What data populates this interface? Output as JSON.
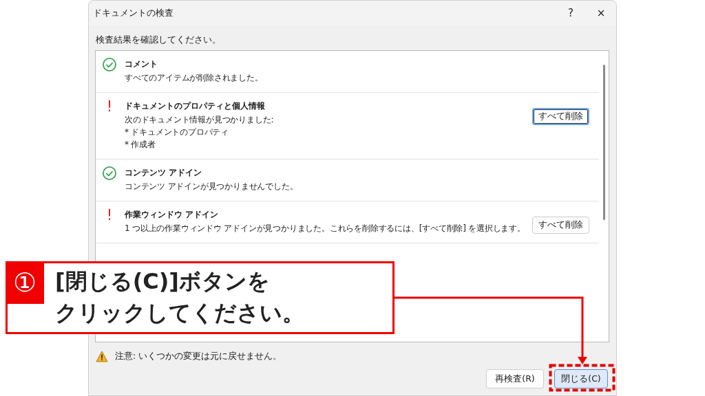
{
  "window": {
    "title": "ドキュメントの検査",
    "help": "?",
    "close": "×"
  },
  "instruction": "検査結果を確認してください。",
  "results": [
    {
      "found": false,
      "title": "コメント",
      "lines": [
        "すべてのアイテムが削除されました。"
      ]
    },
    {
      "found": true,
      "title": "ドキュメントのプロパティと個人情報",
      "lines": [
        "次のドキュメント情報が見つかりました:",
        "* ドキュメントのプロパティ",
        "* 作成者"
      ],
      "button": {
        "label": "すべて削除",
        "focused": true
      }
    },
    {
      "found": false,
      "title": "コンテンツ アドイン",
      "lines": [
        "コンテンツ アドインが見つかりませんでした。"
      ]
    },
    {
      "found": true,
      "title": "作業ウィンドウ アドイン",
      "lines": [
        "1 つ以上の作業ウィンドウ アドインが見つかりました。これらを削除するには、[すべて削除] を選択します。"
      ],
      "button": {
        "label": "すべて削除",
        "focused": false
      }
    }
  ],
  "warning": "注意: いくつかの変更は元に戻せません。",
  "buttons": [
    {
      "label": "再検査(R)",
      "highlighted": false
    },
    {
      "label": "閉じる(C)",
      "highlighted": true
    }
  ],
  "callout": {
    "badge": "①",
    "lines": [
      "[閉じる(C)]ボタンを",
      "クリックしてください。"
    ]
  }
}
